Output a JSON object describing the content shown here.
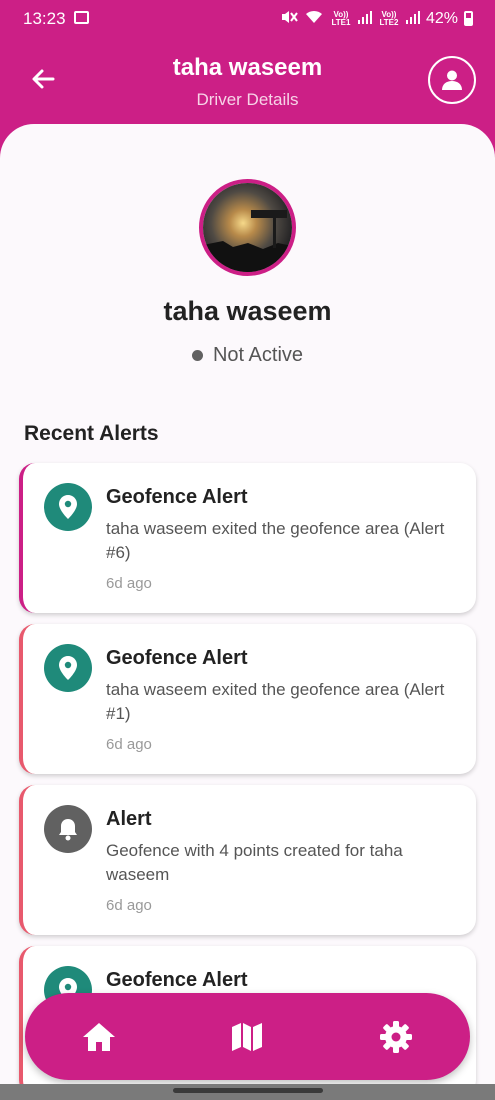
{
  "status_bar": {
    "time": "13:23",
    "battery": "42%",
    "sim1": "Vo)) LTE1",
    "sim2": "Vo)) LTE2"
  },
  "header": {
    "title": "taha waseem",
    "subtitle": "Driver Details",
    "back_icon": "arrow-left-icon",
    "profile_icon": "user-icon"
  },
  "driver": {
    "name": "taha waseem",
    "status": "Not Active"
  },
  "alerts_section": {
    "title": "Recent Alerts",
    "items": [
      {
        "title": "Geofence Alert",
        "message": "taha waseem exited the geofence area (Alert #6)",
        "time": "6d ago",
        "icon": "location-pin-icon"
      },
      {
        "title": "Geofence Alert",
        "message": "taha waseem exited the geofence area (Alert #1)",
        "time": "6d ago",
        "icon": "location-pin-icon"
      },
      {
        "title": "Alert",
        "message": "Geofence with 4 points created for taha waseem",
        "time": "6d ago",
        "icon": "bell-icon"
      },
      {
        "title": "Geofence Alert",
        "icon": "location-pin-icon"
      }
    ]
  },
  "bottom_nav": {
    "items": [
      "home-icon",
      "map-icon",
      "settings-icon"
    ]
  },
  "colors": {
    "primary": "#cc1f86",
    "alert_red": "#e8596d",
    "icon_green": "#1f8a7a",
    "icon_gray": "#616161"
  }
}
